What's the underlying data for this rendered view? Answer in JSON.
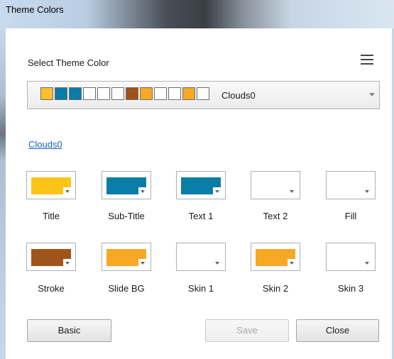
{
  "window": {
    "title": "Theme Colors"
  },
  "select_label": "Select Theme Color",
  "theme_combo": {
    "value": "Clouds0",
    "swatches": [
      "#FBC02D",
      "#0A7CA8",
      "#0A7CA8",
      "#FFFFFF",
      "#FFFFFF",
      "#FFFFFF",
      "#A0521A",
      "#F9A825",
      "#FFFFFF",
      "#FFFFFF",
      "#F9A825",
      "#FFFFFF"
    ]
  },
  "theme_link": "Clouds0",
  "color_slots": [
    {
      "label": "Title",
      "color": "#FCC419"
    },
    {
      "label": "Sub-Title",
      "color": "#0B7EA8"
    },
    {
      "label": "Text 1",
      "color": "#0B7EA8"
    },
    {
      "label": "Text 2",
      "color": "#FFFFFF"
    },
    {
      "label": "Fill",
      "color": "#FFFFFF"
    },
    {
      "label": "Stroke",
      "color": "#A0541A"
    },
    {
      "label": "Slide BG",
      "color": "#F9A825"
    },
    {
      "label": "Skin 1",
      "color": "#FFFFFF"
    },
    {
      "label": "Skin 2",
      "color": "#F9A825"
    },
    {
      "label": "Skin 3",
      "color": "#FFFFFF"
    }
  ],
  "buttons": {
    "basic": "Basic",
    "save": "Save",
    "close": "Close"
  }
}
